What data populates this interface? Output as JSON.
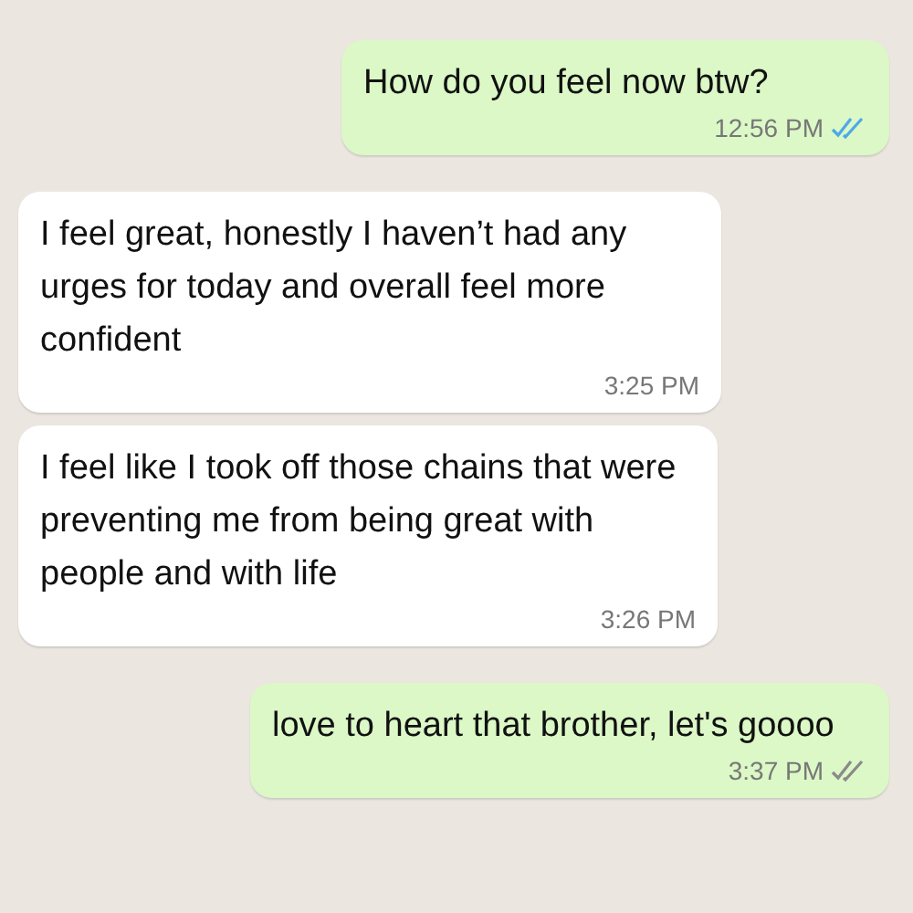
{
  "messages": [
    {
      "kind": "outgoing",
      "text": "How do you feel now btw?",
      "time": "12:56 PM",
      "read": true
    },
    {
      "kind": "incoming",
      "text": "I feel great, honestly I haven’t had any urges for today and overall feel more confident",
      "time": "3:25 PM"
    },
    {
      "kind": "incoming",
      "text": "I feel like I took off those chains that were preventing me from being great with people and with life",
      "time": "3:26 PM"
    },
    {
      "kind": "outgoing",
      "text": "love to heart that brother, let's goooo",
      "time": "3:37 PM",
      "read": false
    }
  ]
}
